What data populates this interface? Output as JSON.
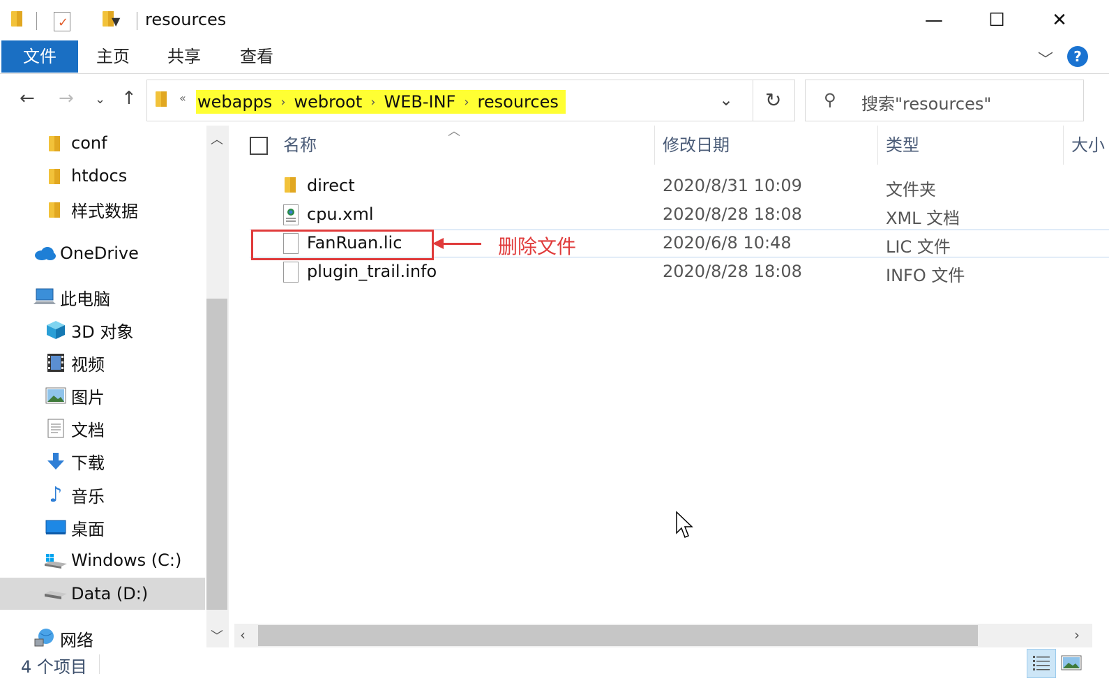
{
  "window": {
    "title": "resources",
    "minimize": "—",
    "maximize": "☐",
    "close": "✕"
  },
  "ribbon": {
    "tabs": [
      "文件",
      "主页",
      "共享",
      "查看"
    ],
    "help": "?"
  },
  "nav": {
    "breadcrumb": [
      "webapps",
      "webroot",
      "WEB-INF",
      "resources"
    ],
    "overflow": "«",
    "search_placeholder": "搜索\"resources\""
  },
  "sidebar": {
    "items": [
      {
        "label": "conf",
        "icon": "folder-icon"
      },
      {
        "label": "htdocs",
        "icon": "folder-icon"
      },
      {
        "label": "样式数据",
        "icon": "folder-icon"
      },
      {
        "label": "OneDrive",
        "icon": "cloud-icon"
      },
      {
        "label": "此电脑",
        "icon": "computer-icon"
      },
      {
        "label": "3D 对象",
        "icon": "cube-icon"
      },
      {
        "label": "视频",
        "icon": "video-icon"
      },
      {
        "label": "图片",
        "icon": "picture-icon"
      },
      {
        "label": "文档",
        "icon": "document-icon"
      },
      {
        "label": "下载",
        "icon": "download-icon"
      },
      {
        "label": "音乐",
        "icon": "music-icon"
      },
      {
        "label": "桌面",
        "icon": "desktop-icon"
      },
      {
        "label": "Windows (C:)",
        "icon": "windows-drive-icon"
      },
      {
        "label": "Data (D:)",
        "icon": "drive-icon"
      },
      {
        "label": "网络",
        "icon": "network-icon"
      }
    ],
    "selected": "Data (D:)"
  },
  "columns": {
    "name": "名称",
    "date": "修改日期",
    "type": "类型",
    "size": "大小"
  },
  "files": [
    {
      "name": "direct",
      "date": "2020/8/31 10:09",
      "type": "文件夹",
      "icon": "folder-icon"
    },
    {
      "name": "cpu.xml",
      "date": "2020/8/28 18:08",
      "type": "XML 文档",
      "icon": "xml-file-icon"
    },
    {
      "name": "FanRuan.lic",
      "date": "2020/6/8 10:48",
      "type": "LIC 文件",
      "icon": "file-icon"
    },
    {
      "name": "plugin_trail.info",
      "date": "2020/8/28 18:08",
      "type": "INFO 文件",
      "icon": "file-icon"
    }
  ],
  "annotation": {
    "text": "删除文件",
    "color": "#e03b3b"
  },
  "status": {
    "count": "4 个项目"
  },
  "colors": {
    "accent": "#1a6fc3",
    "breadcrumb_highlight": "#ffff33"
  }
}
